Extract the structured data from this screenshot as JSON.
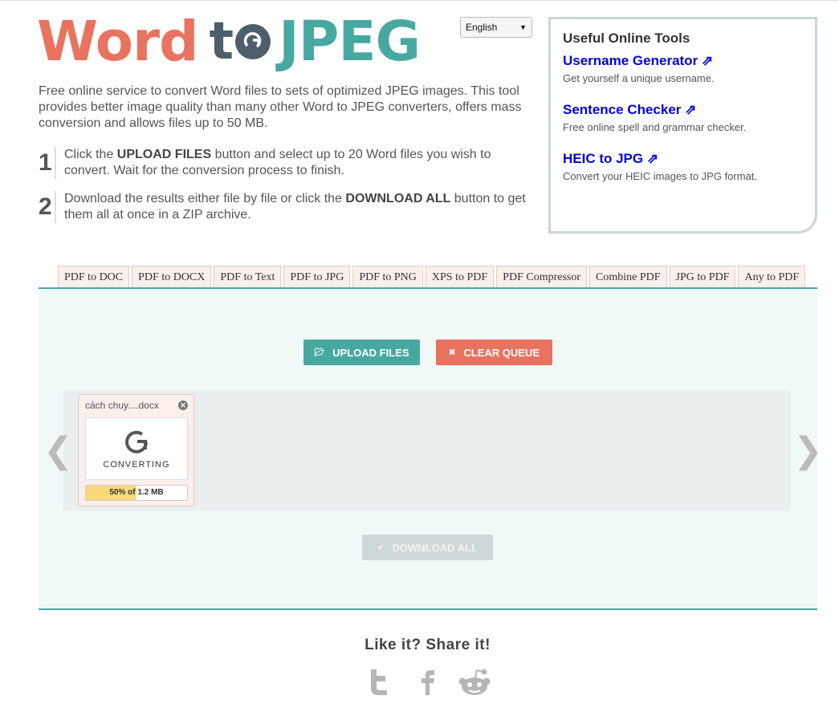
{
  "logo": {
    "word": "Word",
    "to": "to",
    "jpeg": "JPEG"
  },
  "language": {
    "selected": "English"
  },
  "intro": "Free online service to convert Word files to sets of optimized JPEG images. This tool provides better image quality than many other Word to JPEG converters, offers mass conversion and allows files up to 50 MB.",
  "steps": [
    {
      "num": "1",
      "pre": "Click the ",
      "bold": "UPLOAD FILES",
      "post": " button and select up to 20 Word files you wish to convert. Wait for the conversion process to finish."
    },
    {
      "num": "2",
      "pre": "Download the results either file by file or click the ",
      "bold": "DOWNLOAD ALL",
      "post": " button to get them all at once in a ZIP archive."
    }
  ],
  "tools": {
    "title": "Useful Online Tools",
    "items": [
      {
        "label": "Username Generator ⇗",
        "desc": "Get yourself a unique username."
      },
      {
        "label": "Sentence Checker ⇗",
        "desc": "Free online spell and grammar checker."
      },
      {
        "label": "HEIC to JPG ⇗",
        "desc": "Convert your HEIC images to JPG format."
      }
    ]
  },
  "tabs": [
    "PDF to DOC",
    "PDF to DOCX",
    "PDF to Text",
    "PDF to JPG",
    "PDF to PNG",
    "XPS to PDF",
    "PDF Compressor",
    "Combine PDF",
    "JPG to PDF",
    "Any to PDF"
  ],
  "buttons": {
    "upload": "UPLOAD FILES",
    "clear": "CLEAR QUEUE",
    "download_all": "DOWNLOAD ALL"
  },
  "file": {
    "name": "cách chuy....docx",
    "status": "CONVERTING",
    "progress_label": "50% of 1.2 MB",
    "progress": 0.5
  },
  "share": {
    "title": "Like it? Share it!"
  },
  "colors": {
    "teal": "#47a8a2",
    "coral": "#e8735f",
    "slate": "#4d5f6b",
    "link": "#0000e0"
  }
}
